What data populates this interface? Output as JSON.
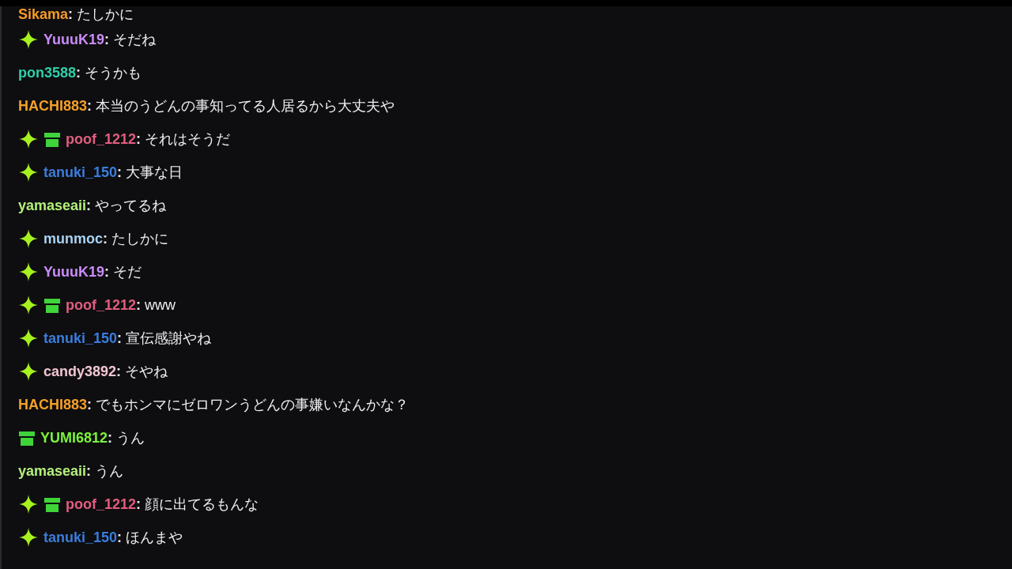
{
  "messages": [
    {
      "user": "Sikama",
      "sep": ":",
      "color": "#f59a23",
      "text": "たしかに"
    },
    {
      "user": "YuuuK19",
      "sep": ":",
      "color": "#c98cf8",
      "badges": [
        {
          "kind": "sparkle"
        }
      ],
      "text": "そだね"
    },
    {
      "user": "pon3588",
      "sep": ":",
      "color": "#2ecfa9",
      "text": "そうかも"
    },
    {
      "user": "HACHI883",
      "sep": ":",
      "color": "#f5a027",
      "text": "本当のうどんの事知ってる人居るから大丈夫や"
    },
    {
      "user": "poof_1212",
      "sep": ":",
      "color": "#e35d7f",
      "badges": [
        {
          "kind": "sparkle"
        },
        {
          "kind": "gift"
        }
      ],
      "text": "それはそうだ"
    },
    {
      "user": "tanuki_150",
      "sep": ":",
      "color": "#3b7ddd",
      "badges": [
        {
          "kind": "sparkle"
        }
      ],
      "text": "大事な日"
    },
    {
      "user": "yamaseaii",
      "sep": ":",
      "color": "#b3f07a",
      "text": "やってるね"
    },
    {
      "user": "munmoc",
      "sep": ":",
      "color": "#a9d2f3",
      "badges": [
        {
          "kind": "sparkle"
        }
      ],
      "text": "たしかに"
    },
    {
      "user": "YuuuK19",
      "sep": ":",
      "color": "#c98cf8",
      "badges": [
        {
          "kind": "sparkle"
        }
      ],
      "text": "そだ"
    },
    {
      "user": "poof_1212",
      "sep": ":",
      "color": "#e35d7f",
      "badges": [
        {
          "kind": "sparkle"
        },
        {
          "kind": "gift"
        }
      ],
      "text": "www"
    },
    {
      "user": "tanuki_150",
      "sep": ":",
      "color": "#3b7ddd",
      "badges": [
        {
          "kind": "sparkle"
        }
      ],
      "text": "宣伝感謝やね"
    },
    {
      "user": "candy3892",
      "sep": ":",
      "color": "#f2c6d2",
      "badges": [
        {
          "kind": "sparkle"
        }
      ],
      "text": "そやね"
    },
    {
      "user": "HACHI883",
      "sep": ":",
      "color": "#f5a027",
      "text": "でもホンマにゼロワンうどんの事嫌いなんかな？"
    },
    {
      "user": "YUMI6812",
      "sep": ":",
      "color": "#7cf23c",
      "badges": [
        {
          "kind": "gift"
        }
      ],
      "text": "うん"
    },
    {
      "user": "yamaseaii",
      "sep": ":",
      "color": "#b3f07a",
      "text": "うん"
    },
    {
      "user": "poof_1212",
      "sep": ":",
      "color": "#e35d7f",
      "badges": [
        {
          "kind": "sparkle"
        },
        {
          "kind": "gift"
        }
      ],
      "text": "顔に出てるもんな"
    },
    {
      "user": "tanuki_150",
      "sep": ":",
      "color": "#3b7ddd",
      "badges": [
        {
          "kind": "sparkle"
        }
      ],
      "text": "ほんまや"
    }
  ]
}
